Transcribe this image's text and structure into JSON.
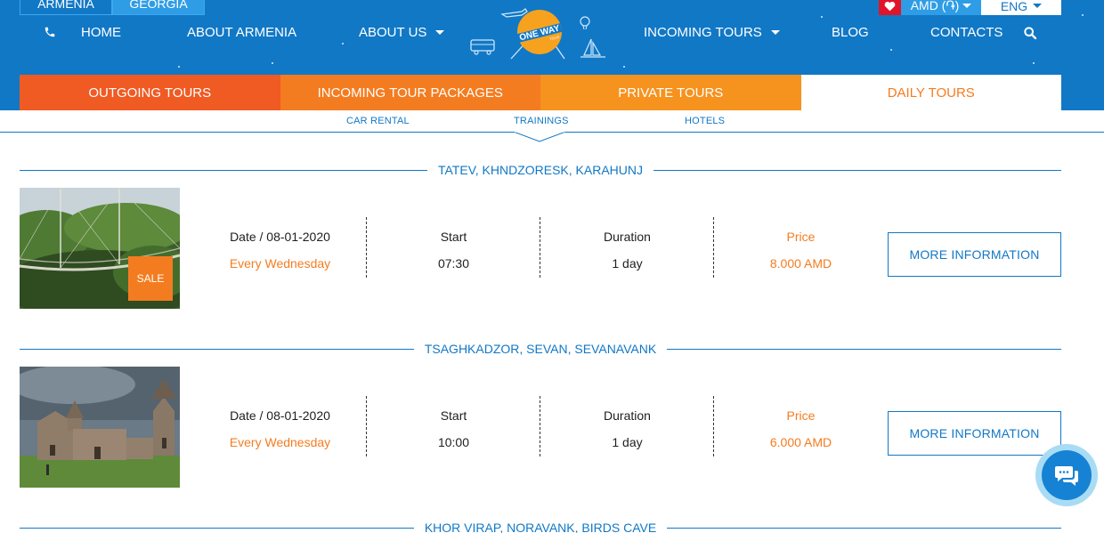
{
  "header": {
    "countries": [
      "ARMENIA",
      "GEORGIA"
    ],
    "currency": "AMD (֏)",
    "language": "ENG",
    "nav": {
      "home": "HOME",
      "about_armenia": "ABOUT ARMENIA",
      "about_us": "ABOUT US",
      "incoming_tours": "INCOMING TOURS",
      "blog": "BLOG",
      "contacts": "CONTACTS"
    },
    "logo_text": "ONE WAY",
    "logo_sub": "TOUR"
  },
  "categories": [
    "OUTGOING TOURS",
    "INCOMING TOUR PACKAGES",
    "PRIVATE TOURS",
    "DAILY TOURS"
  ],
  "subnav": [
    "CAR RENTAL",
    "TRAININGS",
    "HOTELS"
  ],
  "tours": [
    {
      "title": "TATEV, KHNDZORESK, KARAHUNJ",
      "sale": "SALE",
      "date_label": "Date / 08-01-2020",
      "date_value": "Every Wednesday",
      "start_label": "Start",
      "start_value": "07:30",
      "duration_label": "Duration",
      "duration_value": "1 day",
      "price_label": "Price",
      "price_value": "8.000 AMD",
      "button": "MORE INFORMATION"
    },
    {
      "title": "TSAGHKADZOR, SEVAN, SEVANAVANK",
      "date_label": "Date / 08-01-2020",
      "date_value": "Every Wednesday",
      "start_label": "Start",
      "start_value": "10:00",
      "duration_label": "Duration",
      "duration_value": "1 day",
      "price_label": "Price",
      "price_value": "6.000 AMD",
      "button": "MORE INFORMATION"
    },
    {
      "title": "KHOR VIRAP, NORAVANK, BIRDS CAVE"
    }
  ],
  "colors": {
    "brand_blue": "#1178c6",
    "orange": "#f47c20",
    "red_orange": "#f05a23",
    "amber": "#f6921e"
  }
}
